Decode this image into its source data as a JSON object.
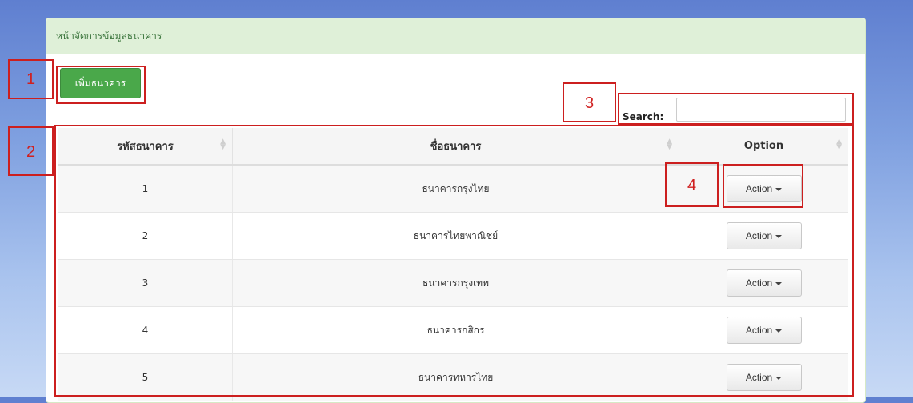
{
  "panel": {
    "title": "หน้าจัดการข้อมูลธนาคาร"
  },
  "toolbar": {
    "add_label": "เพิ่มธนาคาร"
  },
  "search": {
    "label": "Search:",
    "placeholder": "",
    "value": ""
  },
  "markers": [
    "1",
    "2",
    "3",
    "4"
  ],
  "table": {
    "headers": [
      "รหัสธนาคาร",
      "ชื่อธนาคาร",
      "Option"
    ],
    "rows": [
      {
        "id": "1",
        "name": "ธนาคารกรุงไทย",
        "action": "Action"
      },
      {
        "id": "2",
        "name": "ธนาคารไทยพาณิชย์",
        "action": "Action"
      },
      {
        "id": "3",
        "name": "ธนาคารกรุงเทพ",
        "action": "Action"
      },
      {
        "id": "4",
        "name": "ธนาคารกสิกร",
        "action": "Action"
      },
      {
        "id": "5",
        "name": "ธนาคารทหารไทย",
        "action": "Action"
      }
    ]
  },
  "colors": {
    "annotation_red": "#cc1f1f",
    "add_button_green": "#4aa84a",
    "panel_heading_bg": "#dff0d8"
  }
}
